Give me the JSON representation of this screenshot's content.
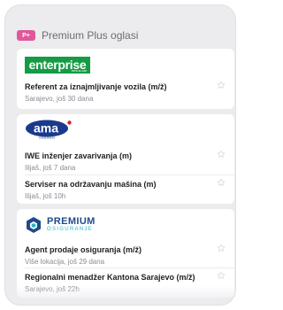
{
  "header": {
    "badge": "P+",
    "title": "Premium Plus oglasi"
  },
  "companies": [
    {
      "name": "enterprise",
      "logo_icon": "enterprise-logo",
      "logo_text": "enterprise",
      "logo_subtext": "rent-a-car",
      "brand_color": "#169b45",
      "jobs": [
        {
          "title": "Referent za iznajmljivanje vozila (m/ž)",
          "meta": "Sarajevo, još 30 dana",
          "star_icon": "star-outline-icon"
        }
      ]
    },
    {
      "name": "ama",
      "logo_icon": "ama-logo",
      "logo_text": "ama",
      "logo_subtext": "mitsubishi",
      "brand_color": "#1a3a8c",
      "jobs": [
        {
          "title": "IWE inženjer zavarivanja (m)",
          "meta": "Ilijaš, još 7 dana",
          "star_icon": "star-outline-icon"
        },
        {
          "title": "Serviser na održavanju mašina (m)",
          "meta": "Ilijaš, još 10h",
          "star_icon": "star-outline-icon"
        }
      ]
    },
    {
      "name": "premium",
      "logo_icon": "premium-osiguranje-logo",
      "logo_text": "PREMIUM",
      "logo_subtext": "OSIGURANJE",
      "brand_color": "#1f4a8a",
      "jobs": [
        {
          "title": "Agent prodaje osiguranja (m/ž)",
          "meta": "Više lokacija, još 29 dana",
          "star_icon": "star-outline-icon"
        },
        {
          "title": "Regionalni menadžer Kantona Sarajevo (m/ž)",
          "meta": "Sarajevo, još 22h",
          "star_icon": "star-outline-icon"
        }
      ]
    }
  ],
  "colors": {
    "background": "#ececef",
    "card": "#ffffff",
    "badge": "#e0579a",
    "title_text": "#1f1f24",
    "meta_text": "#8c8c94"
  }
}
